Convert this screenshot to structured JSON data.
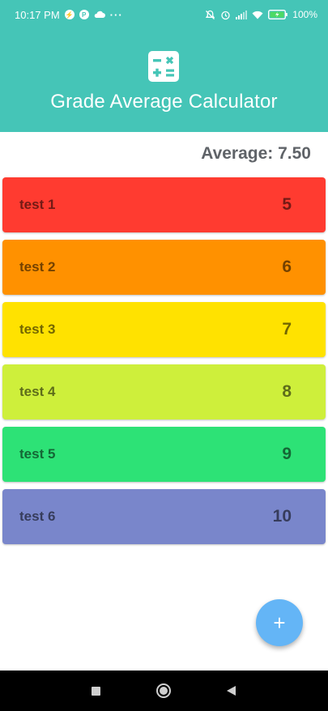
{
  "status": {
    "time": "10:17 PM",
    "battery": "100"
  },
  "header": {
    "title": "Grade Average Calculator"
  },
  "summary": {
    "average_text": "Average: 7.50"
  },
  "grades": [
    {
      "name": "test 1",
      "value": "5",
      "color": "#ff3b30"
    },
    {
      "name": "test 2",
      "value": "6",
      "color": "#ff9100"
    },
    {
      "name": "test 3",
      "value": "7",
      "color": "#ffe200"
    },
    {
      "name": "test 4",
      "value": "8",
      "color": "#ceef3b"
    },
    {
      "name": "test 5",
      "value": "9",
      "color": "#2de276"
    },
    {
      "name": "test 6",
      "value": "10",
      "color": "#7986cb"
    }
  ],
  "fab": {
    "label": "+"
  },
  "colors": {
    "header_bg": "#45c5b7",
    "fab_bg": "#64b5f6",
    "average_text": "#5f6368"
  },
  "icons": {
    "app": "calculator-icon",
    "fab": "plus-icon",
    "nav": [
      "recents-icon",
      "home-icon",
      "back-icon"
    ]
  }
}
